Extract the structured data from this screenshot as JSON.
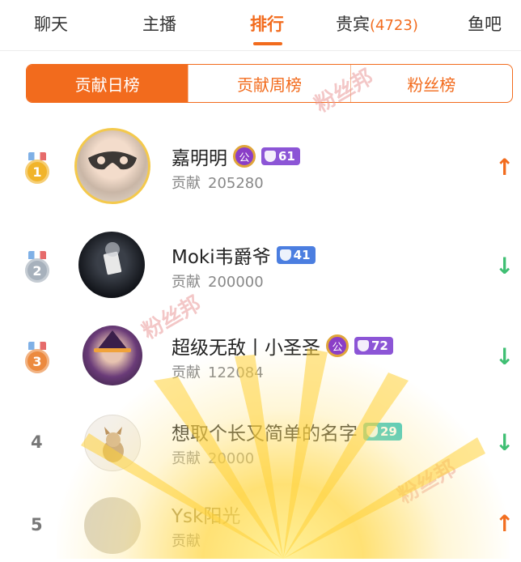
{
  "tabs": {
    "chat": "聊天",
    "host": "主播",
    "rank": "排行",
    "vip": "贵宾",
    "vip_count": "(4723)",
    "fish_bar": "鱼吧"
  },
  "segments": {
    "daily": "贡献日榜",
    "weekly": "贡献周榜",
    "fans": "粉丝榜"
  },
  "watermark": "粉丝邦",
  "contrib_label": "贡献",
  "rows": [
    {
      "rank": "1",
      "name": "嘉明明",
      "crest": "公",
      "level": "61",
      "level_color": "#8c55d6",
      "contribution": "205280",
      "trend": "up",
      "trend_icon": "↑"
    },
    {
      "rank": "2",
      "name": "Moki韦爵爷",
      "level": "41",
      "level_color": "#4b7ee0",
      "contribution": "200000",
      "trend": "down",
      "trend_icon": "↓"
    },
    {
      "rank": "3",
      "name": "超级无敌丨小圣圣",
      "crest": "公",
      "level": "72",
      "level_color": "#8c55d6",
      "contribution": "122084",
      "trend": "down",
      "trend_icon": "↓"
    },
    {
      "rank": "4",
      "name": "想取个长又简单的名字",
      "level": "29",
      "level_color": "#35c6c2",
      "contribution": "20000",
      "trend": "down",
      "trend_icon": "↓"
    },
    {
      "rank": "5",
      "name": "Ysk阳光",
      "contribution": "",
      "trend": "up",
      "trend_icon": "↑"
    }
  ],
  "colors": {
    "accent": "#f26b1d",
    "gold_medal": "#f1b42a",
    "silver_medal": "#a7b1bc",
    "bronze_medal": "#ec8a3f",
    "trend_up": "#f26b1d",
    "trend_down": "#3fbf73"
  },
  "icons": {
    "medal": "medal-icon",
    "trend_up": "arrow-up-icon",
    "trend_down": "arrow-down-icon",
    "level_badge": "shield-icon"
  }
}
